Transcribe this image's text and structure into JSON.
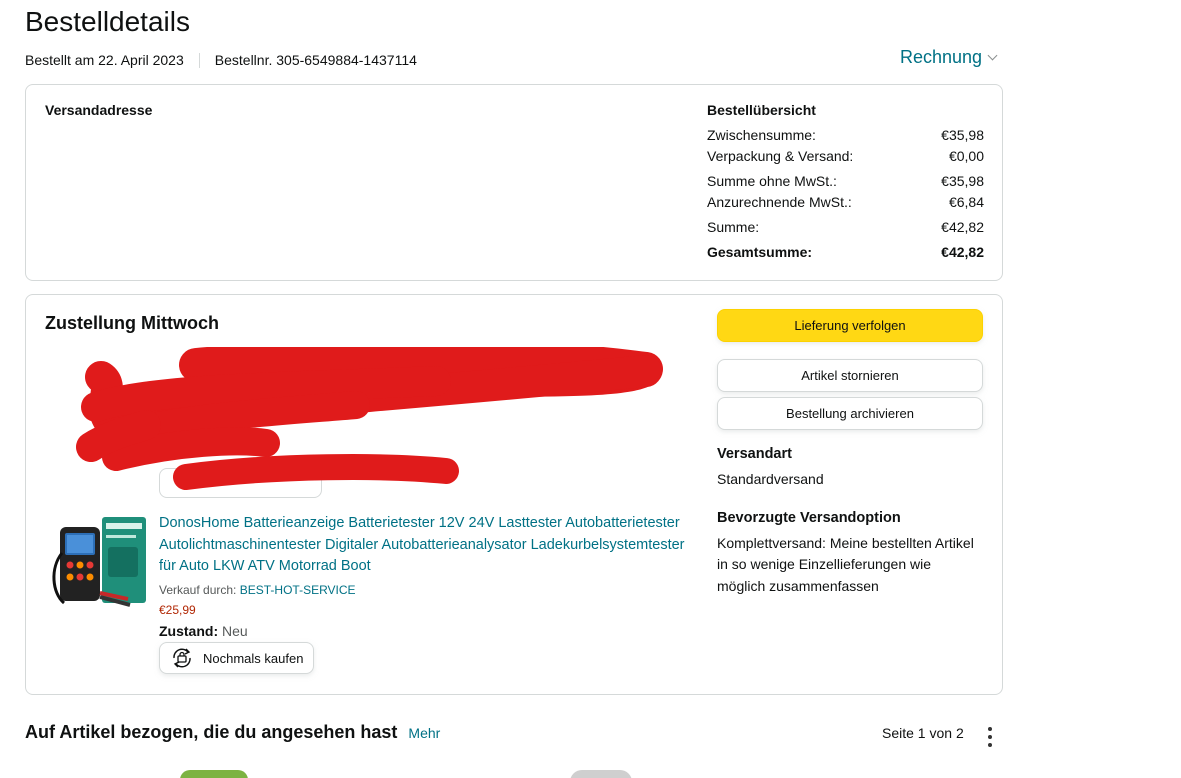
{
  "header": {
    "title": "Bestelldetails",
    "ordered_on": "Bestellt am 22. April 2023",
    "order_number": "Bestellnr. 305-6549884-1437114",
    "invoice_label": "Rechnung"
  },
  "summary": {
    "shipping_address_label": "Versandadresse",
    "overview_title": "Bestellübersicht",
    "rows": [
      {
        "label": "Zwischensumme:",
        "value": "€35,98"
      },
      {
        "label": "Verpackung & Versand:",
        "value": "€0,00"
      },
      {
        "label": "Summe ohne MwSt.:",
        "value": "€35,98"
      },
      {
        "label": "Anzurechnende MwSt.:",
        "value": "€6,84"
      },
      {
        "label": "Summe:",
        "value": "€42,82"
      },
      {
        "label": "Gesamtsumme:",
        "value": "€42,82"
      }
    ]
  },
  "delivery": {
    "title": "Zustellung Mittwoch",
    "redaction_color": "#e01b1b",
    "product": {
      "title": "DonosHome Batterieanzeige Batterietester 12V 24V Lasttester Autobatterietester Autolichtmaschinentester Digitaler Autobatterieanalysator Ladekurbelsystemtester für Auto LKW ATV Motorrad Boot",
      "sold_by_label": "Verkauf durch:",
      "seller": "BEST-HOT-SERVICE",
      "price": "€25,99",
      "condition_label": "Zustand:",
      "condition_value": "Neu",
      "buy_again_label": "Nochmals kaufen",
      "buy_again_icon": "buy-again-icon"
    },
    "actions": {
      "track": "Lieferung verfolgen",
      "cancel": "Artikel stornieren",
      "archive": "Bestellung archivieren"
    },
    "shipping_method_label": "Versandart",
    "shipping_method_value": "Standardversand",
    "preferred_option_label": "Bevorzugte Versandoption",
    "preferred_option_value": "Komplettversand: Meine bestellten Artikel in so wenige Einzellieferungen wie möglich zusammenfassen"
  },
  "recommendations": {
    "title": "Auf Artikel bezogen, die du angesehen hast",
    "more_label": "Mehr",
    "pager": "Seite 1 von 2"
  },
  "colors": {
    "link": "#007185",
    "primary_button": "#ffd814",
    "price": "#b12704",
    "border": "#d5d9d9"
  }
}
